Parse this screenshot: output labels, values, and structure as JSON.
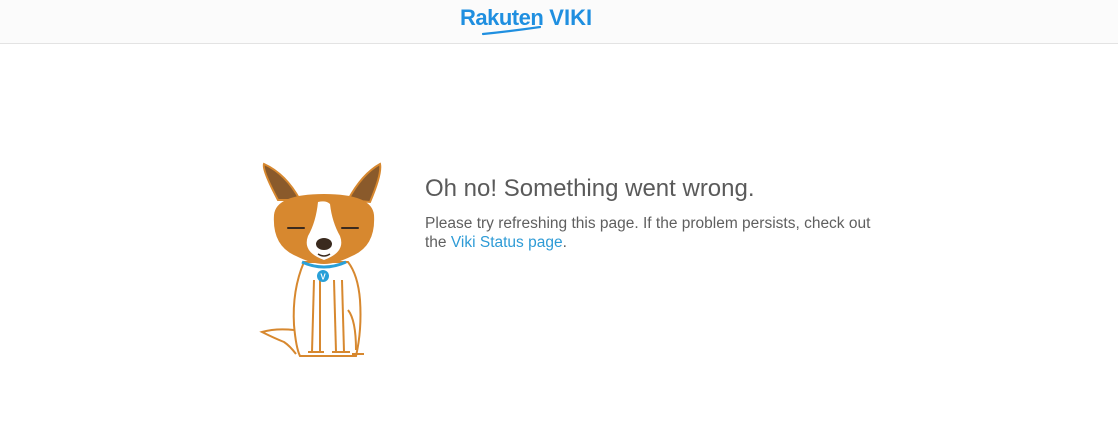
{
  "header": {
    "logo_brand": "Rakuten",
    "logo_product": "VIKI"
  },
  "error": {
    "title": "Oh no! Something went wrong.",
    "description_prefix": "Please try refreshing this page. If the problem persists, check out the ",
    "status_link": "Viki Status page",
    "description_suffix": "."
  },
  "colors": {
    "brand": "#1f8fe0",
    "link": "#2e9bd6",
    "text": "#5a5a5a"
  }
}
